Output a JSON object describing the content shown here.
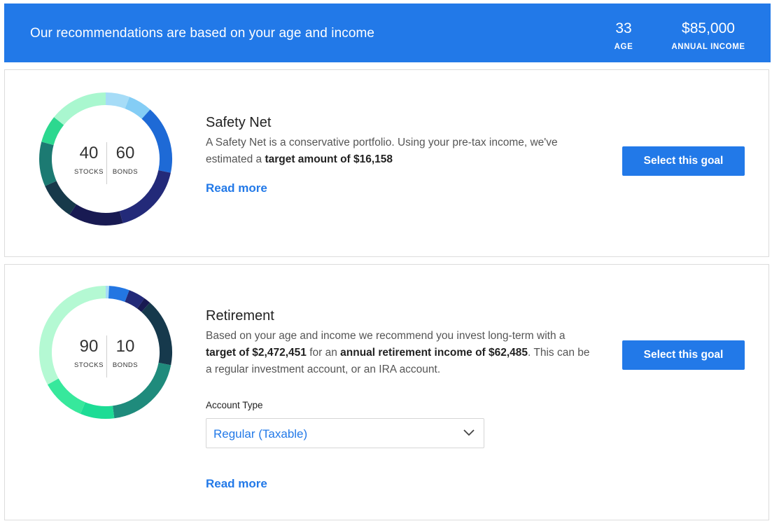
{
  "banner": {
    "title": "Our recommendations are based on your age and income",
    "age_value": "33",
    "age_label": "AGE",
    "income_value": "$85,000",
    "income_label": "ANNUAL INCOME"
  },
  "goals": [
    {
      "title": "Safety Net",
      "stocks": "40",
      "bonds": "60",
      "stocks_label": "STOCKS",
      "bonds_label": "BONDS",
      "desc_1": "A Safety Net is a conservative portfolio. Using your pre-tax income, we've estimated a ",
      "desc_bold_1": "target amount of $16,158",
      "read_more": "Read more",
      "button": "Select this goal"
    },
    {
      "title": "Retirement",
      "stocks": "90",
      "bonds": "10",
      "stocks_label": "STOCKS",
      "bonds_label": "BONDS",
      "desc_1": "Based on your age and income we recommend you invest long-term with a ",
      "desc_bold_1": "target of $2,472,451",
      "desc_2": " for an ",
      "desc_bold_2": "annual retirement income of $62,485",
      "desc_3": ". This can be a regular investment account, or an IRA account.",
      "account_type_label": "Account Type",
      "account_type_value": "Regular (Taxable)",
      "read_more": "Read more",
      "button": "Select this goal"
    }
  ],
  "colors": {
    "accent": "#2279e8",
    "donut1": [
      "#a6dcf7",
      "#84cdf5",
      "#1e6ad6",
      "#232a79",
      "#181a52",
      "#17394a",
      "#1c7a72",
      "#2cd88f",
      "#a9f7cf"
    ],
    "donut2": [
      "#a6dcf7",
      "#2376e2",
      "#232a79",
      "#181a52",
      "#16394c",
      "#1f8b7c",
      "#1ddc95",
      "#37e89c",
      "#b4f9d3"
    ]
  },
  "donut_segments": {
    "safety_net": [
      7,
      7,
      20,
      21,
      16,
      11,
      13,
      8,
      17
    ],
    "retirement": [
      1,
      6,
      5,
      2,
      20,
      24,
      10,
      13,
      40
    ]
  },
  "icons": {
    "select_chevron": "chevron-down-icon"
  }
}
